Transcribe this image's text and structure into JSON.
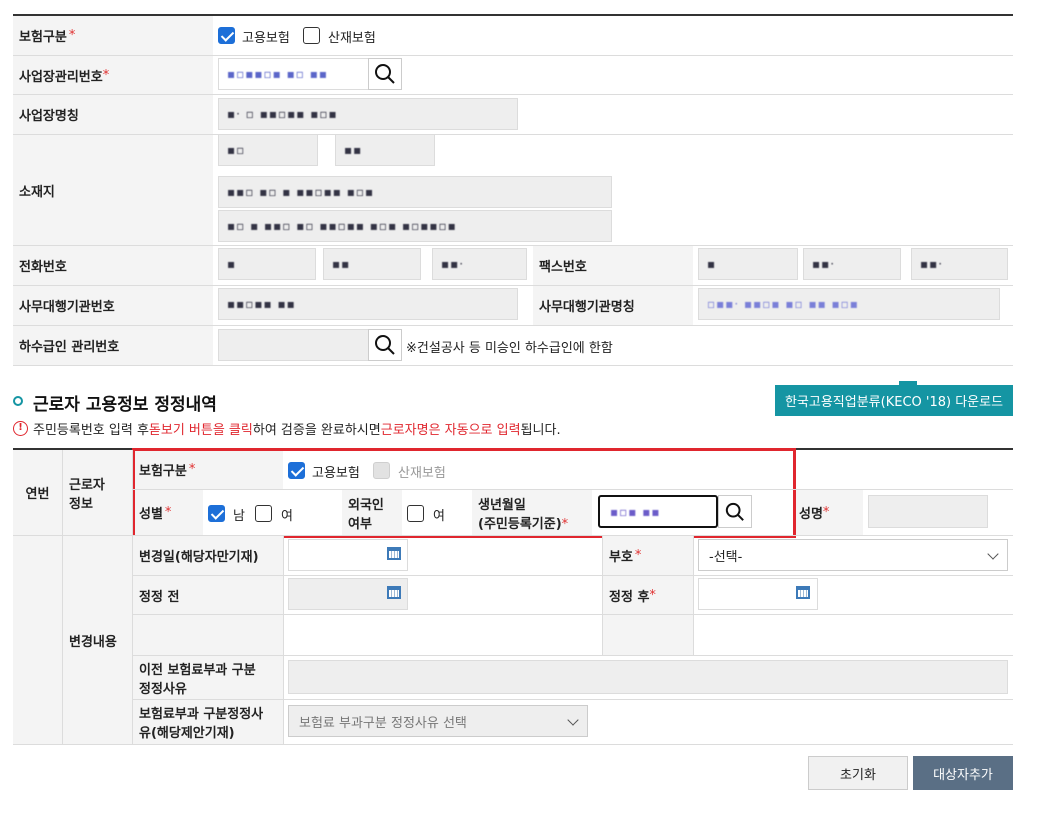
{
  "top_form": {
    "insurance_type_label": "보험구분",
    "insurance_options": [
      "고용보험",
      "산재보험"
    ],
    "workplace_no_label": "사업장관리번호",
    "workplace_no_value": "▪▫▪▪▫▪ ▪▫ ▪▪",
    "workplace_name_label": "사업장명칭",
    "workplace_name_value": "▪· ▫ ▪▪▫▪▪ ▪▫▪",
    "address_label": "소재지",
    "address_values": [
      "▪▫",
      "▪▪",
      "▪▪▫ ▪▫ ▪ ▪▪▫▪▪ ▪▫▪",
      "▪▫ ▪ ▪▪▫ ▪▫ ▪▪▫▪▪ ▪▫▪ ▪▫▪▪▫▪"
    ],
    "phone_label": "전화번호",
    "phone_values": [
      "▪",
      "▪▪",
      "▪▪·"
    ],
    "fax_label": "팩스번호",
    "fax_values": [
      "▪",
      "▪▪·",
      "▪▪·"
    ],
    "agency_no_label": "사무대행기관번호",
    "agency_no_value": "▪▪▫▪▪ ▪▪",
    "agency_name_label": "사무대행기관명칭",
    "agency_name_value": "▫▪▪· ▪▪▫▪ ▪▫ ▪▪ ▪▫▪",
    "subcontractor_label": "하수급인 관리번호",
    "subcontractor_note": "※건설공사 등 미승인 하수급인에 한함"
  },
  "section": {
    "title": "근로자 고용정보 정정내역",
    "download_button": "한국고용직업분류(KECO '18) 다운로드",
    "notice_prefix": "주민등록번호 입력 후 ",
    "notice_red1": "돋보기 버튼을 클릭",
    "notice_mid": "하여 검증을 완료하시면 ",
    "notice_red2": "근로자명은 자동으로 입력",
    "notice_suffix": "됩니다."
  },
  "worker_table": {
    "col_seq": "연번",
    "col_worker_info_line1": "근로자",
    "col_worker_info_line2": "정보",
    "insurance_type_label": "보험구분",
    "insurance_options": [
      "고용보험",
      "산재보험"
    ],
    "gender_label": "성별",
    "gender_options": [
      "남",
      "여"
    ],
    "foreigner_label_line1": "외국인",
    "foreigner_label_line2": "여부",
    "foreigner_option": "여",
    "birth_label_line1": "생년월일",
    "birth_label_line2": "(주민등록기준)",
    "birth_value": "▪▫▪ ▪▪",
    "name_label": "성명",
    "change_content_label": "변경내용",
    "change_date_label": "변경일(해당자만기재)",
    "sign_label": "부호",
    "sign_select_value": "-선택-",
    "before_label": "정정 전",
    "after_label": "정정 후",
    "prev_reason_label_line1": "이전 보험료부과 구분",
    "prev_reason_label_line2": "정정사유",
    "reason_label_line1": "보험료부과 구분정정사",
    "reason_label_line2": "유(해당제안기재)",
    "reason_select_placeholder": "보험료 부과구분 정정사유 선택"
  },
  "buttons": {
    "reset": "초기화",
    "add_target": "대상자추가"
  },
  "colors": {
    "accent_teal": "#1595a3",
    "highlight_red": "#e0262e",
    "checkbox_blue": "#1d6fd8",
    "primary_button": "#5a6f85"
  },
  "icons": [
    "search-icon",
    "calendar-icon",
    "chevron-down-icon",
    "alert-circle-icon",
    "bullet-circle-icon"
  ]
}
